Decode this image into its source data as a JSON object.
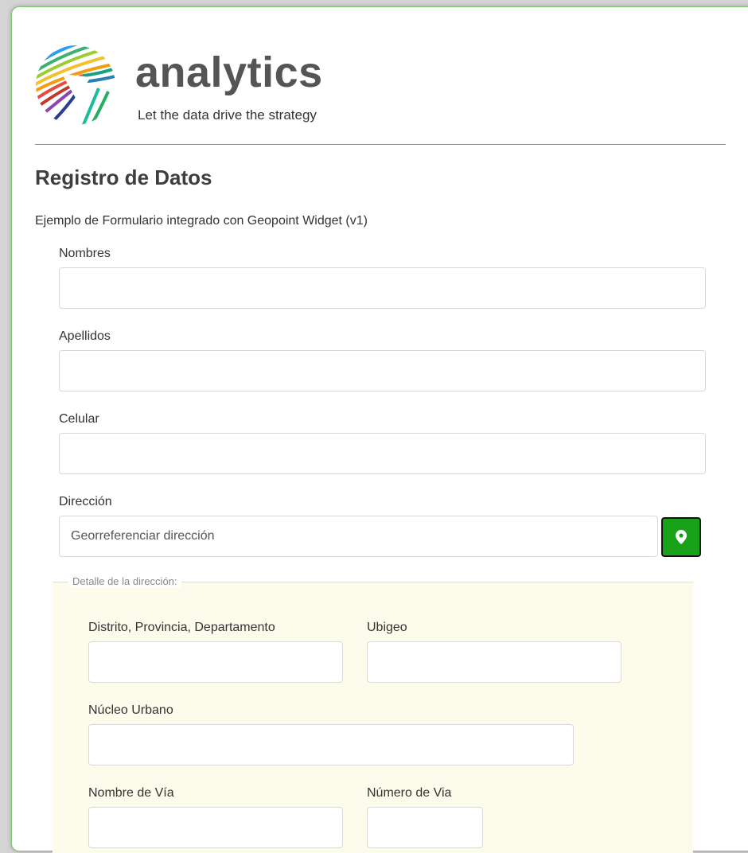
{
  "brand": {
    "name": "analytics",
    "tagline": "Let the data drive the strategy",
    "colors": {
      "green": "#1aa11a",
      "border": "#7cc66b"
    }
  },
  "form": {
    "title": "Registro de Datos",
    "description": "Ejemplo de Formulario integrado con Geopoint Widget (v1)",
    "fields": {
      "nombres": {
        "label": "Nombres",
        "value": ""
      },
      "apellidos": {
        "label": "Apellidos",
        "value": ""
      },
      "celular": {
        "label": "Celular",
        "value": ""
      },
      "direccion": {
        "label": "Dirección",
        "placeholder": "Georreferenciar dirección",
        "button_icon": "map-pin-icon"
      }
    },
    "address_detail": {
      "legend": "Detalle de la dirección:",
      "fields": {
        "distrito": {
          "label": "Distrito, Provincia, Departamento",
          "value": ""
        },
        "ubigeo": {
          "label": "Ubigeo",
          "value": ""
        },
        "nucleo": {
          "label": "Núcleo Urbano",
          "value": ""
        },
        "nombre_via": {
          "label": "Nombre de Vía",
          "value": ""
        },
        "numero_via": {
          "label": "Número de Via",
          "value": ""
        }
      }
    }
  }
}
